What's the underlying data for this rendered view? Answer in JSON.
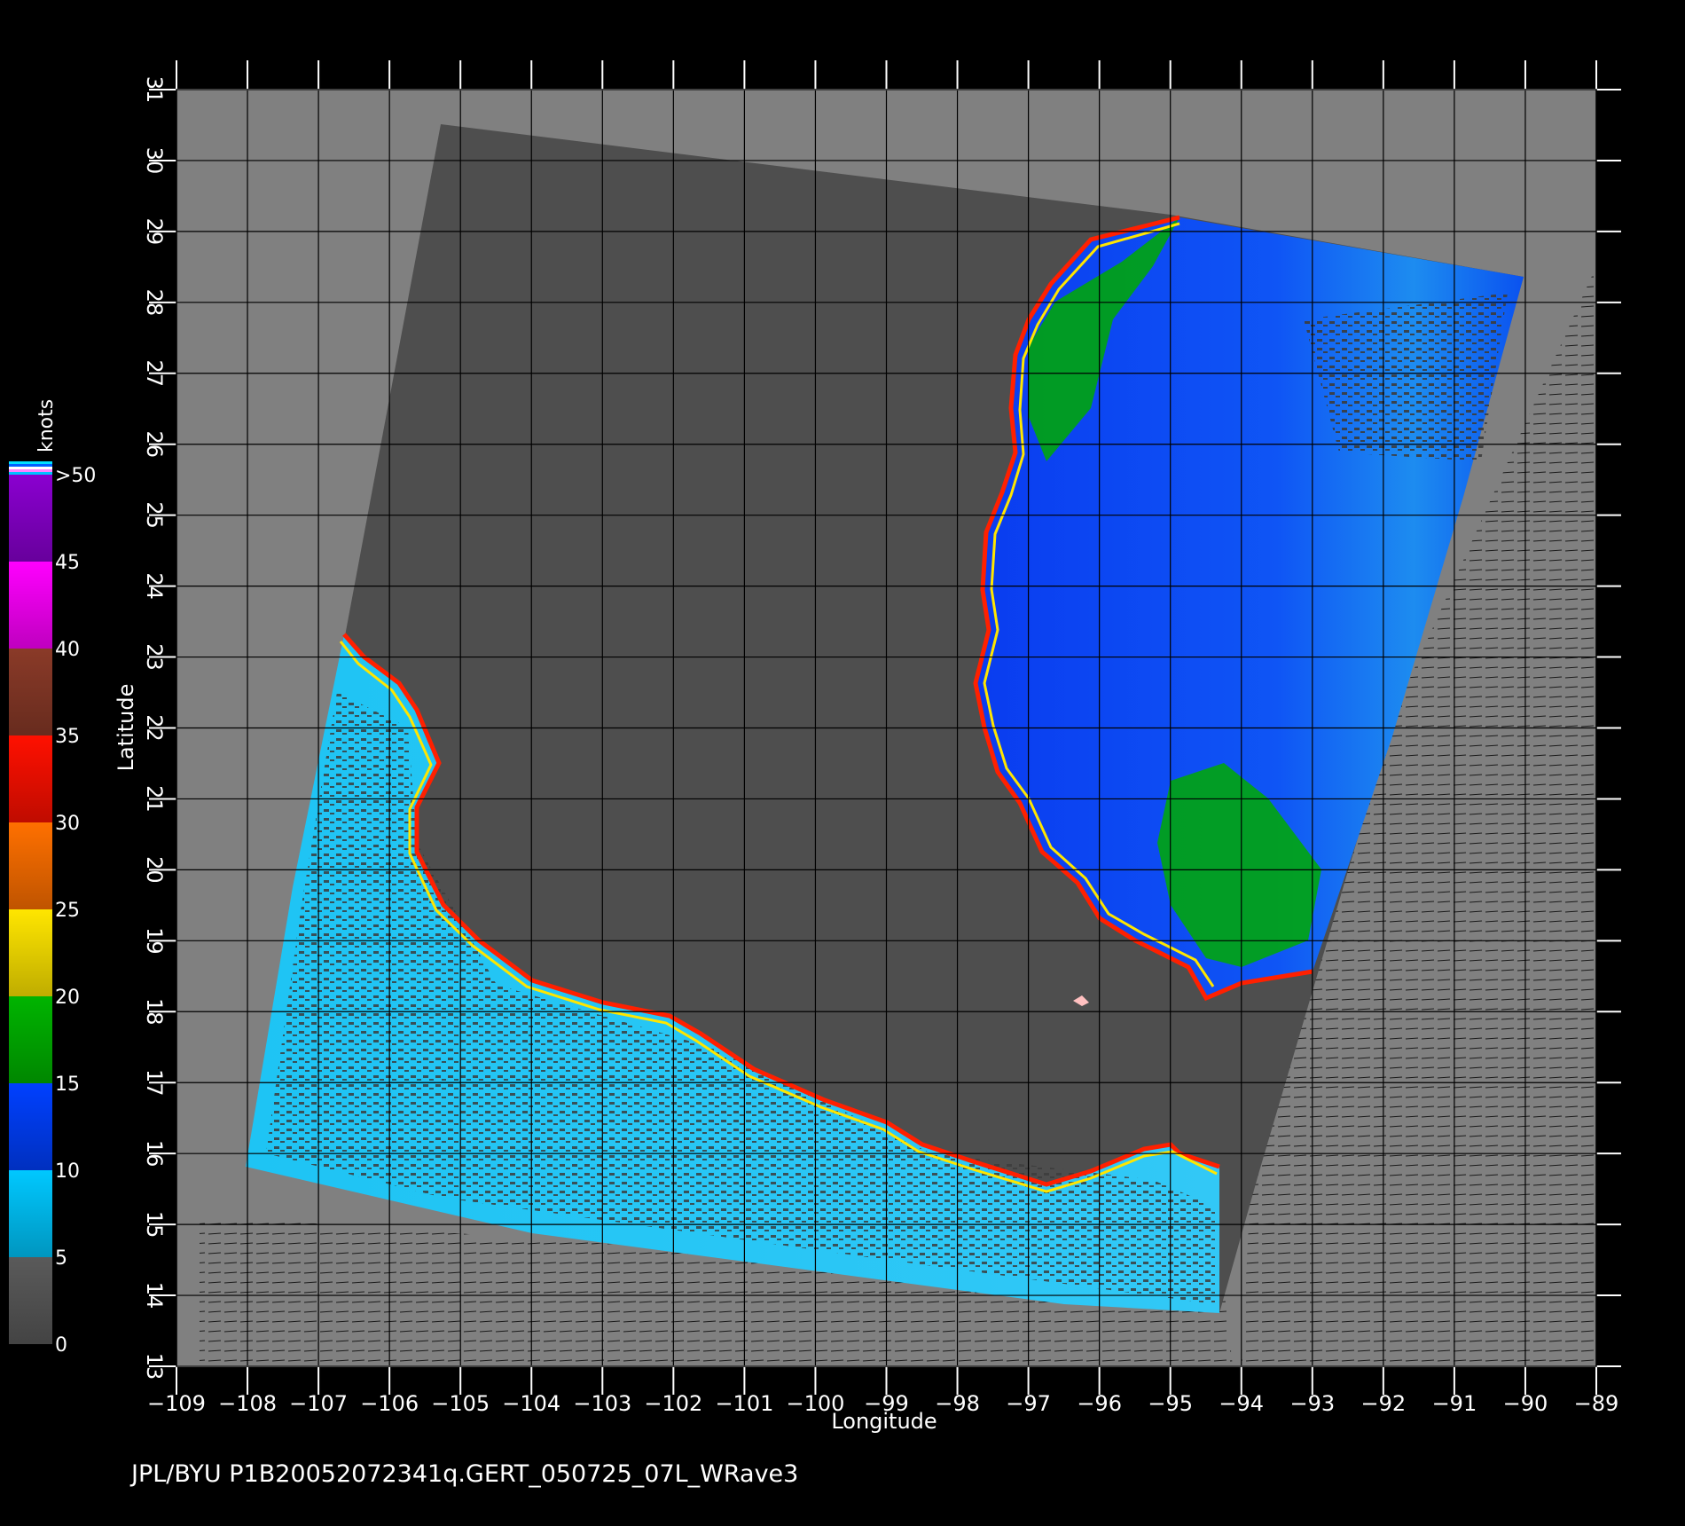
{
  "map": {
    "xlabel": "Longitude",
    "ylabel": "Latitude",
    "lon_range": [
      -109,
      -89
    ],
    "lat_range": [
      13,
      31
    ],
    "lon_ticks": [
      "−109",
      "−108",
      "−107",
      "−106",
      "−105",
      "−104",
      "−103",
      "−102",
      "−101",
      "−100",
      "−99",
      "−98",
      "−97",
      "−96",
      "−95",
      "−94",
      "−93",
      "−92",
      "−91",
      "−90",
      "−89"
    ],
    "lat_ticks": [
      "13",
      "14",
      "15",
      "16",
      "17",
      "18",
      "19",
      "20",
      "21",
      "22",
      "23",
      "24",
      "25",
      "26",
      "27",
      "28",
      "29",
      "30",
      "31"
    ],
    "grid": true
  },
  "colorbar": {
    "unit": "knots",
    "labels": [
      ">50",
      "45",
      "40",
      "35",
      "30",
      "25",
      "20",
      "15",
      "10",
      "5",
      "0"
    ],
    "bands": [
      {
        "from": 0,
        "to": 5,
        "color": "#5a5a5a"
      },
      {
        "from": 5,
        "to": 10,
        "color": "#00c8ff"
      },
      {
        "from": 10,
        "to": 15,
        "color": "#0040ff"
      },
      {
        "from": 15,
        "to": 20,
        "color": "#00b400"
      },
      {
        "from": 20,
        "to": 25,
        "color": "#ffe600"
      },
      {
        "from": 25,
        "to": 30,
        "color": "#ff7000"
      },
      {
        "from": 30,
        "to": 35,
        "color": "#ff1000"
      },
      {
        "from": 35,
        "to": 40,
        "color": "#8a3a28"
      },
      {
        "from": 40,
        "to": 45,
        "color": "#ff00ff"
      },
      {
        "from": 45,
        "to": 50,
        "color": "#8a00d0"
      }
    ]
  },
  "footer": "JPL/BYU  P1B20052072341q.GERT_050725_07L_WRave3",
  "colors": {
    "background": "#000000",
    "map_bg": "#808080",
    "swath_land": "#4e4e4e",
    "ocean_low": "#00c8ff",
    "ocean_mid": "#0040ff",
    "ocean_high": "#00b400",
    "coast": "#ff2000"
  }
}
